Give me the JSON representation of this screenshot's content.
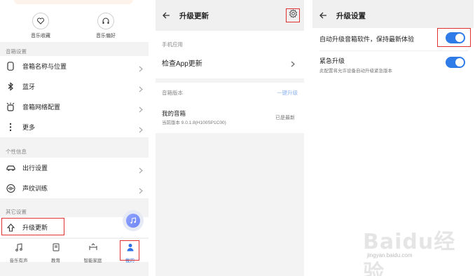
{
  "panel1": {
    "quick_actions": [
      {
        "label": "音乐收藏",
        "icon": "heart-icon"
      },
      {
        "label": "音乐偏好",
        "icon": "headphones-icon"
      }
    ],
    "section_speaker": "音箱设置",
    "speaker_items": [
      {
        "label": "音箱名称与位置",
        "icon": "speaker-icon"
      },
      {
        "label": "蓝牙",
        "icon": "bluetooth-icon"
      },
      {
        "label": "音箱网络配置",
        "icon": "network-icon"
      },
      {
        "label": "更多",
        "icon": "more-icon"
      }
    ],
    "section_personal": "个性信息",
    "personal_items": [
      {
        "label": "出行设置",
        "icon": "car-icon"
      },
      {
        "label": "声纹训练",
        "icon": "voiceprint-icon"
      }
    ],
    "section_other": "其它设置",
    "other_items": [
      {
        "label": "升级更新",
        "icon": "upgrade-icon"
      }
    ],
    "tabs": [
      {
        "label": "音乐有声",
        "icon": "music-tab-icon"
      },
      {
        "label": "教育",
        "icon": "book-tab-icon"
      },
      {
        "label": "智能家庭",
        "icon": "home-tab-icon"
      },
      {
        "label": "我的",
        "icon": "person-tab-icon"
      }
    ],
    "active_tab": "我的"
  },
  "panel2": {
    "title": "升级更新",
    "section_app": "手机应用",
    "check_app": "检查App更新",
    "section_version": "音箱版本",
    "update_all": "一键升级",
    "device_name": "我的音箱",
    "device_version": "当前版本 9.0.1.8(H100SP1C00)",
    "device_status": "已是最新"
  },
  "panel3": {
    "title": "升级设置",
    "auto_upgrade_label": "自动升级音箱软件，保持最新体验",
    "emergency_label": "紧急升级",
    "emergency_desc": "此配置将允许设备自动升级紧急版本",
    "auto_upgrade_on": true,
    "emergency_on": true
  },
  "watermark": {
    "brand": "Baidu经验",
    "url": "jingyan.baidu.com"
  },
  "colors": {
    "accent": "#2f7be8",
    "highlight": "#e03030",
    "link_faded": "#8db4f0"
  }
}
